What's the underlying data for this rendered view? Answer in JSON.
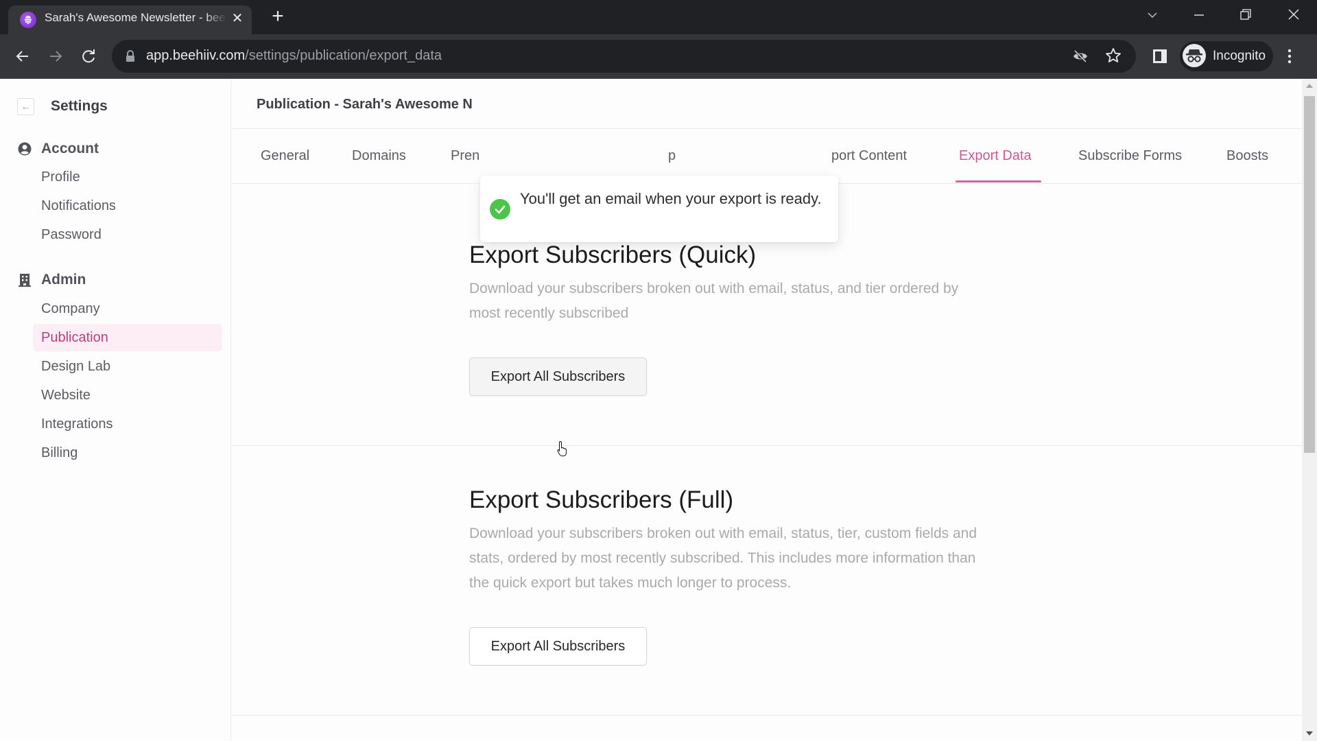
{
  "browser": {
    "tab_title": "Sarah's Awesome Newsletter - beehiiv",
    "tab_close_icon": "close-icon",
    "new_tab_icon": "plus-icon",
    "url_domain": "app.beehiiv.com",
    "url_path": "/settings/publication/export_data",
    "profile_label": "Incognito",
    "window_controls": [
      "tab-search-icon",
      "minimize-icon",
      "restore-icon",
      "close-icon"
    ]
  },
  "sidebar": {
    "title": "Settings",
    "groups": [
      {
        "label": "Account",
        "icon": "user-circle-icon",
        "items": [
          {
            "label": "Profile"
          },
          {
            "label": "Notifications"
          },
          {
            "label": "Password"
          }
        ]
      },
      {
        "label": "Admin",
        "icon": "building-icon",
        "items": [
          {
            "label": "Company"
          },
          {
            "label": "Publication",
            "active": true
          },
          {
            "label": "Design Lab"
          },
          {
            "label": "Website"
          },
          {
            "label": "Integrations"
          },
          {
            "label": "Billing"
          }
        ]
      }
    ]
  },
  "main": {
    "header_title": "Publication - Sarah's Awesome N",
    "tabs": [
      {
        "label": "General"
      },
      {
        "label": "Domains"
      },
      {
        "label": "Pren"
      },
      {
        "label": "p"
      },
      {
        "label": "port Content"
      },
      {
        "label": "Export Data",
        "active": true
      },
      {
        "label": "Subscribe Forms"
      },
      {
        "label": "Boosts"
      }
    ],
    "sections": [
      {
        "title": "Export Subscribers (Quick)",
        "description": "Download your subscribers broken out with email, status, and tier ordered by most recently subscribed",
        "button_label": "Export All Subscribers"
      },
      {
        "title": "Export Subscribers (Full)",
        "description": "Download your subscribers broken out with email, status, tier, custom fields and stats, ordered by most recently subscribed. This includes more information than the quick export but takes much longer to process.",
        "button_label": "Export All Subscribers"
      }
    ]
  },
  "toast": {
    "message": "You'll get an email when your export is ready.",
    "icon": "check-circle-icon",
    "status_color": "#4cc44a"
  },
  "colors": {
    "accent": "#c9589a",
    "active_sidebar_bg": "#fdeef6",
    "active_sidebar_text": "#b5407f"
  }
}
